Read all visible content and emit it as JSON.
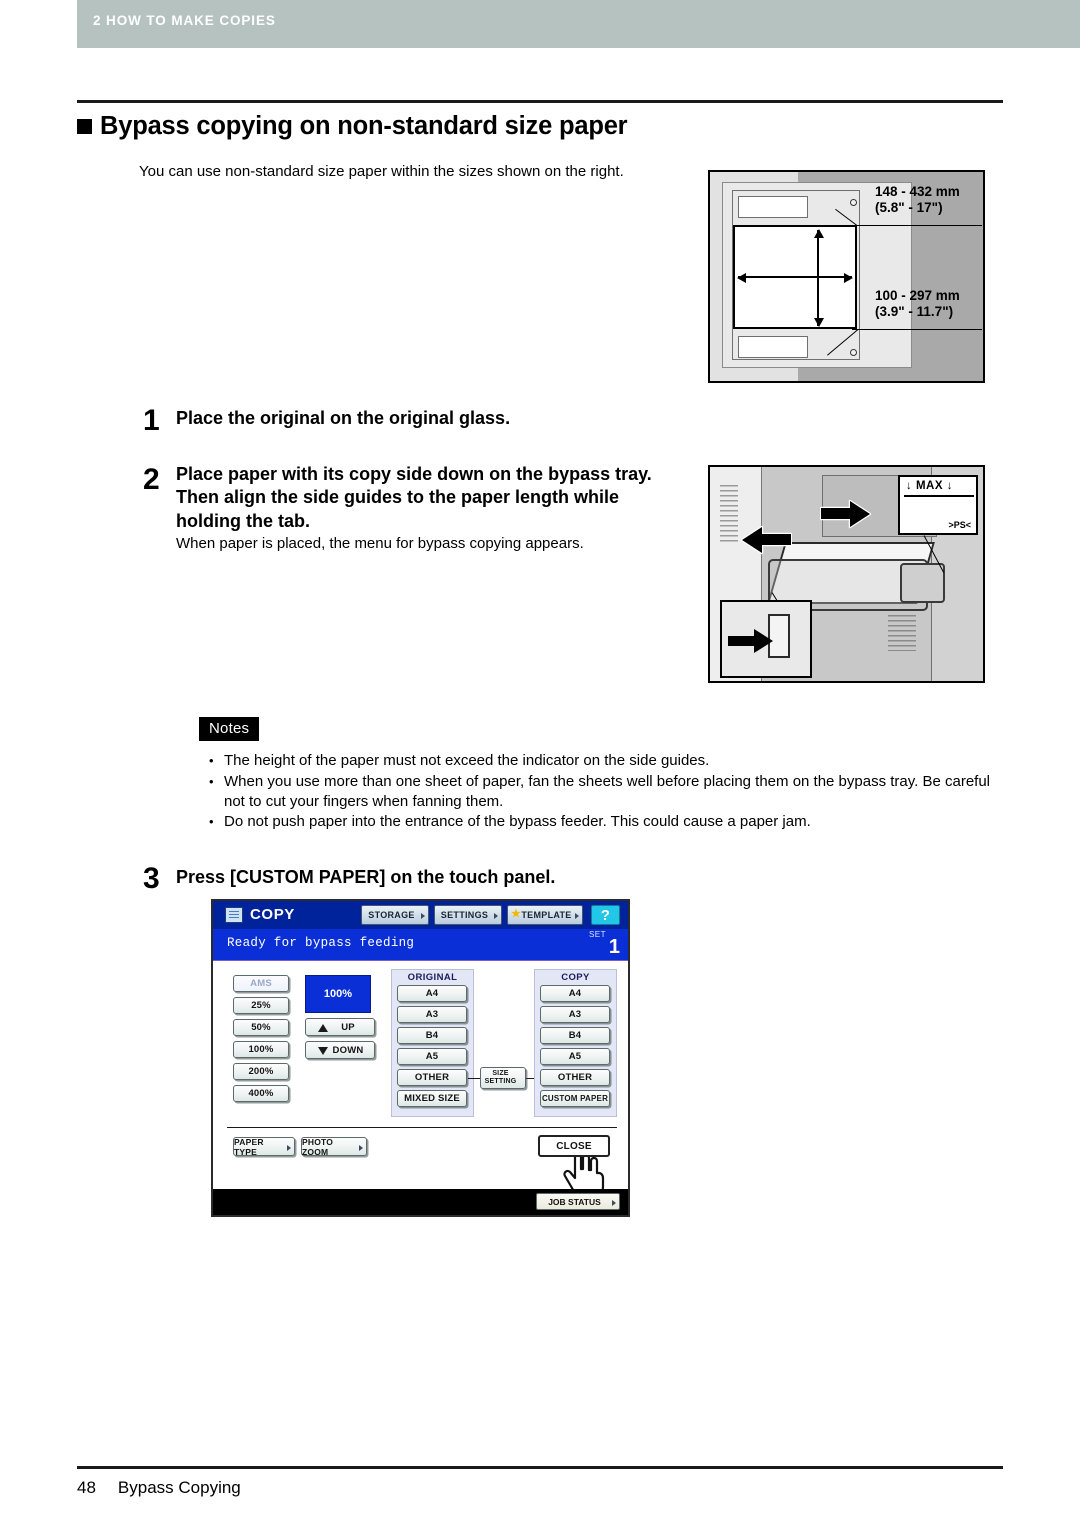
{
  "header": {
    "chapter": "2 HOW TO MAKE COPIES"
  },
  "section": {
    "title": "Bypass copying on non-standard size paper",
    "intro": "You can use non-standard size paper within the sizes shown on the right."
  },
  "size_figure": {
    "label_length": "148 - 432 mm\n(5.8\" - 17\")",
    "label_width": "100 - 297 mm\n(3.9\" - 11.7\")"
  },
  "steps": [
    {
      "number": "1",
      "text": "Place the original on the original glass.",
      "note": ""
    },
    {
      "number": "2",
      "text": "Place paper with its copy side down on the bypass tray. Then align the side guides to the paper length while holding the tab.",
      "note": "When paper is placed, the menu for bypass copying appears."
    },
    {
      "number": "3",
      "text": "Press [CUSTOM PAPER] on the touch panel.",
      "note": ""
    }
  ],
  "tray_figure": {
    "max_label": "MAX",
    "ps_label": ">PS<"
  },
  "notes": {
    "tag": "Notes",
    "bullet": "•",
    "items": [
      "The height of the paper must not exceed the indicator on the side guides.",
      "When you use more than one sheet of paper, fan the sheets well before placing them on the bypass tray. Be careful not to cut your fingers when fanning them.",
      "Do not push paper into the entrance of the bypass feeder. This could cause a paper jam."
    ]
  },
  "touch_panel": {
    "title": "COPY",
    "toolbar": {
      "storage": "STORAGE",
      "settings": "SETTINGS",
      "template": "TEMPLATE",
      "help": "?"
    },
    "status": {
      "message": "Ready for bypass feeding",
      "set_label": "SET",
      "set_count": "1"
    },
    "zoom_column": {
      "ams": "AMS",
      "presets": [
        "25%",
        "50%",
        "100%",
        "200%",
        "400%"
      ],
      "current": "100%",
      "up": "UP",
      "down": "DOWN"
    },
    "original_group": {
      "title": "ORIGINAL",
      "buttons": [
        "A4",
        "A3",
        "B4",
        "A5",
        "OTHER",
        "MIXED SIZE"
      ]
    },
    "copy_group": {
      "title": "COPY",
      "buttons": [
        "A4",
        "A3",
        "B4",
        "A5",
        "OTHER",
        "CUSTOM PAPER"
      ]
    },
    "size_setting": "SIZE\nSETTING",
    "bottom_buttons": {
      "paper_type": "PAPER TYPE",
      "photo_zoom": "PHOTO ZOOM",
      "close": "CLOSE"
    },
    "job_status": "JOB STATUS"
  },
  "footer": {
    "page_number": "48",
    "section_name": "Bypass Copying"
  },
  "colors": {
    "chapter_band": "#b5c2c0",
    "panel_blue": "#0b2fd6",
    "titlebar_blue": "#00229b",
    "help_cyan": "#22c6e6",
    "group_bg": "#e3e6f5"
  }
}
